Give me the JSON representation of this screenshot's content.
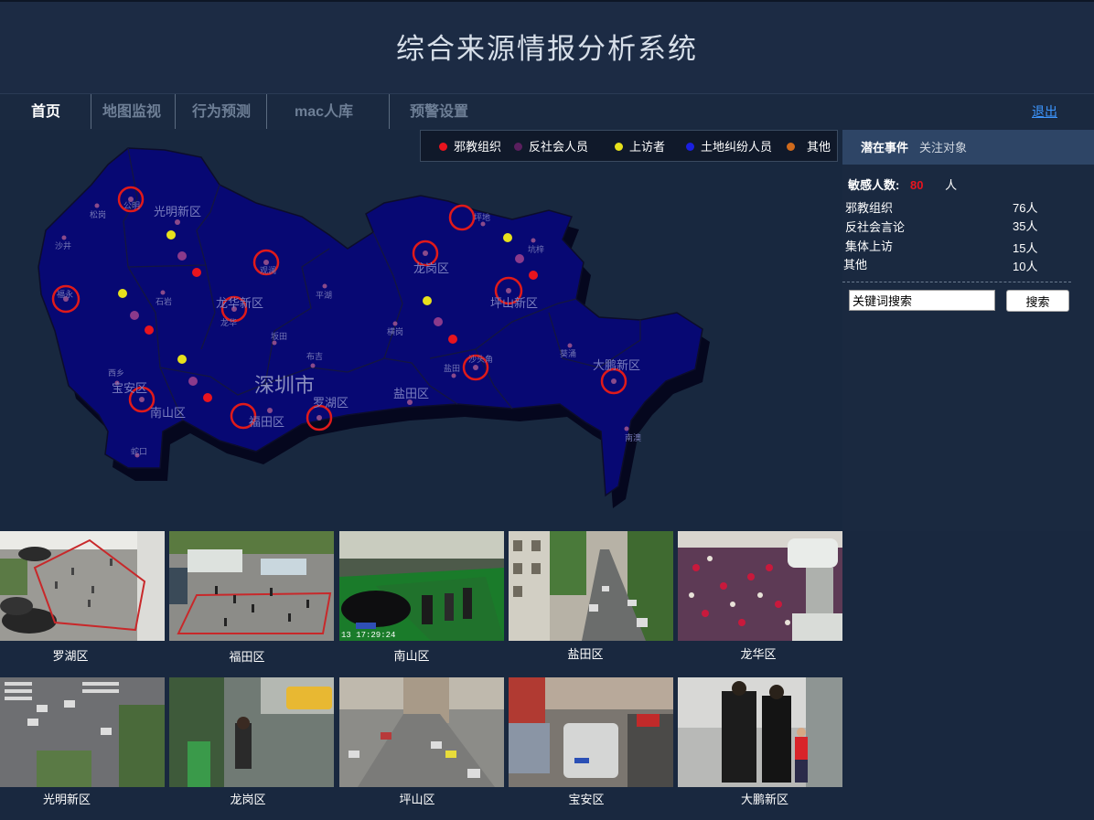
{
  "header": {
    "title": "综合来源情报分析系统"
  },
  "nav": {
    "items": [
      {
        "label": "首页",
        "active": true
      },
      {
        "label": "地图监视",
        "active": false
      },
      {
        "label": "行为预测",
        "active": false
      },
      {
        "label": "mac人库",
        "active": false
      },
      {
        "label": "预警设置",
        "active": false
      }
    ],
    "logout": "退出"
  },
  "legend": [
    {
      "label": "邪教组织",
      "color": "#e8141e"
    },
    {
      "label": "反社会人员",
      "color": "#5a1f5e"
    },
    {
      "label": "上访者",
      "color": "#e7e11c"
    },
    {
      "label": "土地纠纷人员",
      "color": "#1a1fe0"
    },
    {
      "label": "其他",
      "color": "#d06a1c"
    }
  ],
  "map": {
    "city": "深圳市",
    "districts": [
      "光明新区",
      "龙华新区",
      "龙岗区",
      "坪山新区",
      "宝安区",
      "南山区",
      "福田区",
      "罗湖区",
      "盐田区",
      "大鹏新区"
    ],
    "places": [
      "松岗",
      "公明",
      "沙井",
      "福永",
      "石岩",
      "观澜",
      "平湖",
      "坪地",
      "坑梓",
      "龙华",
      "坂田",
      "横岗",
      "布吉",
      "西乡",
      "盐田",
      "沙头角",
      "葵涌",
      "南澳",
      "蛇口"
    ]
  },
  "panel": {
    "tabs": [
      "潜在事件",
      "关注对象"
    ],
    "sensitive_label": "敏感人数:",
    "sensitive_value": "80",
    "sensitive_unit": "人",
    "stats": [
      {
        "label": "邪教组织",
        "value": "76人"
      },
      {
        "label": "反社会言论",
        "value": "35人"
      },
      {
        "label": "集体上访",
        "value": "15人"
      },
      {
        "label": "其他",
        "value": "10人"
      }
    ],
    "search_value": "关键词搜索",
    "search_button": "搜索"
  },
  "cameras": [
    {
      "label": "罗湖区"
    },
    {
      "label": "福田区"
    },
    {
      "label": "南山区"
    },
    {
      "label": "盐田区"
    },
    {
      "label": "龙华区"
    },
    {
      "label": "光明新区"
    },
    {
      "label": "龙岗区"
    },
    {
      "label": "坪山区"
    },
    {
      "label": "宝安区"
    },
    {
      "label": "大鹏新区"
    }
  ],
  "camera_overlays": {
    "timestamp": "13 17:29:24"
  }
}
